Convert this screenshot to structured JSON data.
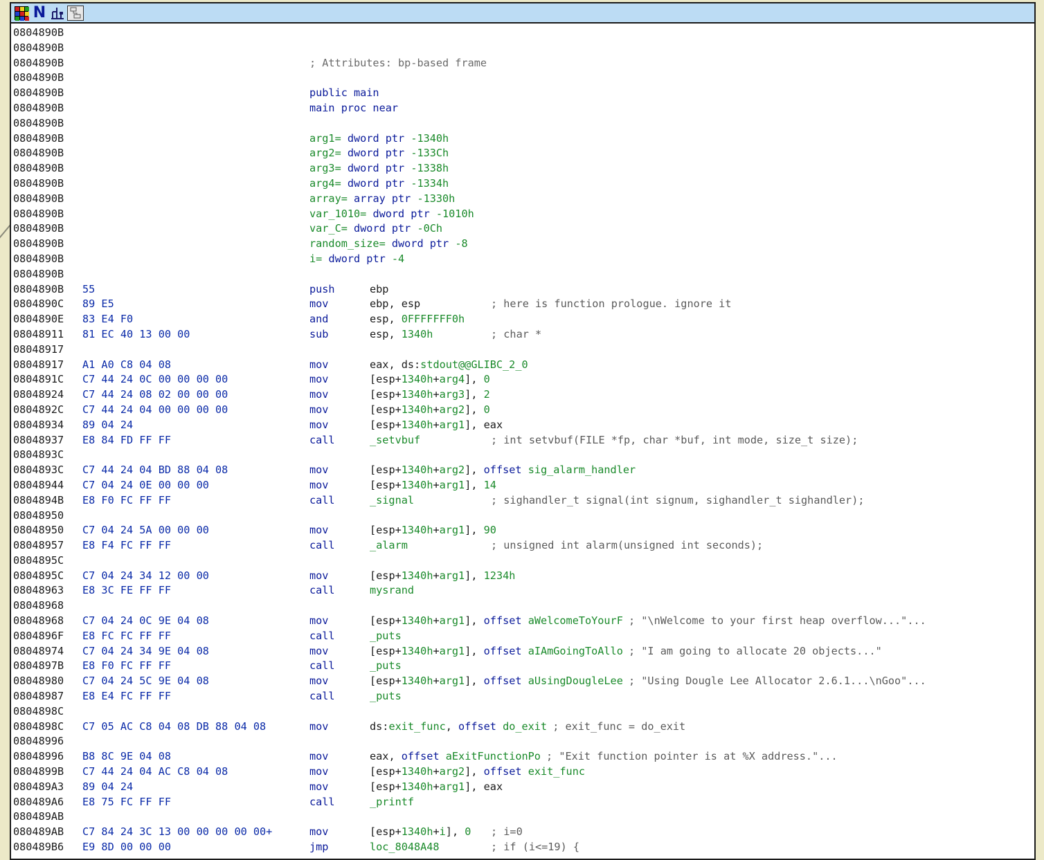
{
  "toolbar": {
    "icons": [
      "graph-colors-icon",
      "n-letter-icon",
      "tree-icon",
      "graph-overview-icon"
    ],
    "n_label": "N"
  },
  "header_rows": [
    {
      "addr": "0804890B",
      "text": ""
    },
    {
      "addr": "0804890B",
      "text": ""
    },
    {
      "addr": "0804890B",
      "text": "; Attributes: bp-based frame",
      "kind": "comment"
    },
    {
      "addr": "0804890B",
      "text": ""
    },
    {
      "addr": "0804890B",
      "text": "public main",
      "kind": "decl"
    },
    {
      "addr": "0804890B",
      "text": "main proc near",
      "kind": "decl"
    },
    {
      "addr": "0804890B",
      "text": ""
    },
    {
      "addr": "0804890B",
      "text": "arg1= dword ptr -1340h",
      "kind": "var"
    },
    {
      "addr": "0804890B",
      "text": "arg2= dword ptr -133Ch",
      "kind": "var"
    },
    {
      "addr": "0804890B",
      "text": "arg3= dword ptr -1338h",
      "kind": "var"
    },
    {
      "addr": "0804890B",
      "text": "arg4= dword ptr -1334h",
      "kind": "var"
    },
    {
      "addr": "0804890B",
      "text": "array= array ptr -1330h",
      "kind": "var"
    },
    {
      "addr": "0804890B",
      "text": "var_1010= dword ptr -1010h",
      "kind": "var"
    },
    {
      "addr": "0804890B",
      "text": "var_C= dword ptr -0Ch",
      "kind": "var"
    },
    {
      "addr": "0804890B",
      "text": "random_size= dword ptr -8",
      "kind": "var"
    },
    {
      "addr": "0804890B",
      "text": "i= dword ptr -4",
      "kind": "var"
    },
    {
      "addr": "0804890B",
      "text": ""
    }
  ],
  "code_rows": [
    {
      "addr": "0804890B",
      "bytes": "55",
      "mnemonic": "push",
      "operands": "ebp",
      "comment": ""
    },
    {
      "addr": "0804890C",
      "bytes": "89 E5",
      "mnemonic": "mov",
      "operands": "ebp, esp",
      "comment": "; here is function prologue. ignore it"
    },
    {
      "addr": "0804890E",
      "bytes": "83 E4 F0",
      "mnemonic": "and",
      "operands": "esp, 0FFFFFFF0h",
      "comment": ""
    },
    {
      "addr": "08048911",
      "bytes": "81 EC 40 13 00 00",
      "mnemonic": "sub",
      "operands": "esp, 1340h",
      "comment": "; char *"
    },
    {
      "addr": "08048917",
      "bytes": "",
      "mnemonic": "",
      "operands": "",
      "comment": ""
    },
    {
      "addr": "08048917",
      "bytes": "A1 A0 C8 04 08",
      "mnemonic": "mov",
      "operands": "eax, ds:stdout@@GLIBC_2_0",
      "comment": ""
    },
    {
      "addr": "0804891C",
      "bytes": "C7 44 24 0C 00 00 00 00",
      "mnemonic": "mov",
      "operands": "[esp+1340h+arg4], 0",
      "comment": ""
    },
    {
      "addr": "08048924",
      "bytes": "C7 44 24 08 02 00 00 00",
      "mnemonic": "mov",
      "operands": "[esp+1340h+arg3], 2",
      "comment": ""
    },
    {
      "addr": "0804892C",
      "bytes": "C7 44 24 04 00 00 00 00",
      "mnemonic": "mov",
      "operands": "[esp+1340h+arg2], 0",
      "comment": ""
    },
    {
      "addr": "08048934",
      "bytes": "89 04 24",
      "mnemonic": "mov",
      "operands": "[esp+1340h+arg1], eax",
      "comment": ""
    },
    {
      "addr": "08048937",
      "bytes": "E8 84 FD FF FF",
      "mnemonic": "call",
      "operands": "_setvbuf",
      "comment": "; int setvbuf(FILE *fp, char *buf, int mode, size_t size);"
    },
    {
      "addr": "0804893C",
      "bytes": "",
      "mnemonic": "",
      "operands": "",
      "comment": ""
    },
    {
      "addr": "0804893C",
      "bytes": "C7 44 24 04 BD 88 04 08",
      "mnemonic": "mov",
      "operands": "[esp+1340h+arg2], offset sig_alarm_handler",
      "comment": ""
    },
    {
      "addr": "08048944",
      "bytes": "C7 04 24 0E 00 00 00",
      "mnemonic": "mov",
      "operands": "[esp+1340h+arg1], 14",
      "comment": ""
    },
    {
      "addr": "0804894B",
      "bytes": "E8 F0 FC FF FF",
      "mnemonic": "call",
      "operands": "_signal",
      "comment": "; sighandler_t signal(int signum, sighandler_t sighandler);"
    },
    {
      "addr": "08048950",
      "bytes": "",
      "mnemonic": "",
      "operands": "",
      "comment": ""
    },
    {
      "addr": "08048950",
      "bytes": "C7 04 24 5A 00 00 00",
      "mnemonic": "mov",
      "operands": "[esp+1340h+arg1], 90",
      "comment": ""
    },
    {
      "addr": "08048957",
      "bytes": "E8 F4 FC FF FF",
      "mnemonic": "call",
      "operands": "_alarm",
      "comment": "; unsigned int alarm(unsigned int seconds);"
    },
    {
      "addr": "0804895C",
      "bytes": "",
      "mnemonic": "",
      "operands": "",
      "comment": ""
    },
    {
      "addr": "0804895C",
      "bytes": "C7 04 24 34 12 00 00",
      "mnemonic": "mov",
      "operands": "[esp+1340h+arg1], 1234h",
      "comment": ""
    },
    {
      "addr": "08048963",
      "bytes": "E8 3C FE FF FF",
      "mnemonic": "call",
      "operands": "mysrand",
      "comment": ""
    },
    {
      "addr": "08048968",
      "bytes": "",
      "mnemonic": "",
      "operands": "",
      "comment": ""
    },
    {
      "addr": "08048968",
      "bytes": "C7 04 24 0C 9E 04 08",
      "mnemonic": "mov",
      "operands": "[esp+1340h+arg1], offset aWelcomeToYourF",
      "comment": "; \"\\nWelcome to your first heap overflow...\"..."
    },
    {
      "addr": "0804896F",
      "bytes": "E8 FC FC FF FF",
      "mnemonic": "call",
      "operands": "_puts",
      "comment": ""
    },
    {
      "addr": "08048974",
      "bytes": "C7 04 24 34 9E 04 08",
      "mnemonic": "mov",
      "operands": "[esp+1340h+arg1], offset aIAmGoingToAllo",
      "comment": "; \"I am going to allocate 20 objects...\""
    },
    {
      "addr": "0804897B",
      "bytes": "E8 F0 FC FF FF",
      "mnemonic": "call",
      "operands": "_puts",
      "comment": ""
    },
    {
      "addr": "08048980",
      "bytes": "C7 04 24 5C 9E 04 08",
      "mnemonic": "mov",
      "operands": "[esp+1340h+arg1], offset aUsingDougleLee",
      "comment": "; \"Using Dougle Lee Allocator 2.6.1...\\nGoo\"..."
    },
    {
      "addr": "08048987",
      "bytes": "E8 E4 FC FF FF",
      "mnemonic": "call",
      "operands": "_puts",
      "comment": ""
    },
    {
      "addr": "0804898C",
      "bytes": "",
      "mnemonic": "",
      "operands": "",
      "comment": ""
    },
    {
      "addr": "0804898C",
      "bytes": "C7 05 AC C8 04 08 DB 88 04 08",
      "mnemonic": "mov",
      "operands": "ds:exit_func, offset do_exit",
      "comment": "; exit_func = do_exit"
    },
    {
      "addr": "08048996",
      "bytes": "",
      "mnemonic": "",
      "operands": "",
      "comment": ""
    },
    {
      "addr": "08048996",
      "bytes": "B8 8C 9E 04 08",
      "mnemonic": "mov",
      "operands": "eax, offset aExitFunctionPo",
      "comment": "; \"Exit function pointer is at %X address.\"..."
    },
    {
      "addr": "0804899B",
      "bytes": "C7 44 24 04 AC C8 04 08",
      "mnemonic": "mov",
      "operands": "[esp+1340h+arg2], offset exit_func",
      "comment": ""
    },
    {
      "addr": "080489A3",
      "bytes": "89 04 24",
      "mnemonic": "mov",
      "operands": "[esp+1340h+arg1], eax",
      "comment": ""
    },
    {
      "addr": "080489A6",
      "bytes": "E8 75 FC FF FF",
      "mnemonic": "call",
      "operands": "_printf",
      "comment": ""
    },
    {
      "addr": "080489AB",
      "bytes": "",
      "mnemonic": "",
      "operands": "",
      "comment": ""
    },
    {
      "addr": "080489AB",
      "bytes": "C7 84 24 3C 13 00 00 00 00 00+",
      "mnemonic": "mov",
      "operands": "[esp+1340h+i], 0",
      "comment": "; i=0"
    },
    {
      "addr": "080489B6",
      "bytes": "E9 8D 00 00 00",
      "mnemonic": "jmp",
      "operands": "loc_8048A48",
      "comment": "; if (i<=19) {"
    }
  ],
  "colors": {
    "address": "#1a1a1a",
    "bytes": "#0a2aa8",
    "mnemonic": "#0a1a9a",
    "name": "#1a8a2a",
    "comment": "#6a6a6a",
    "titlebar": "#bcdcf4",
    "background": "#ece9c8"
  }
}
